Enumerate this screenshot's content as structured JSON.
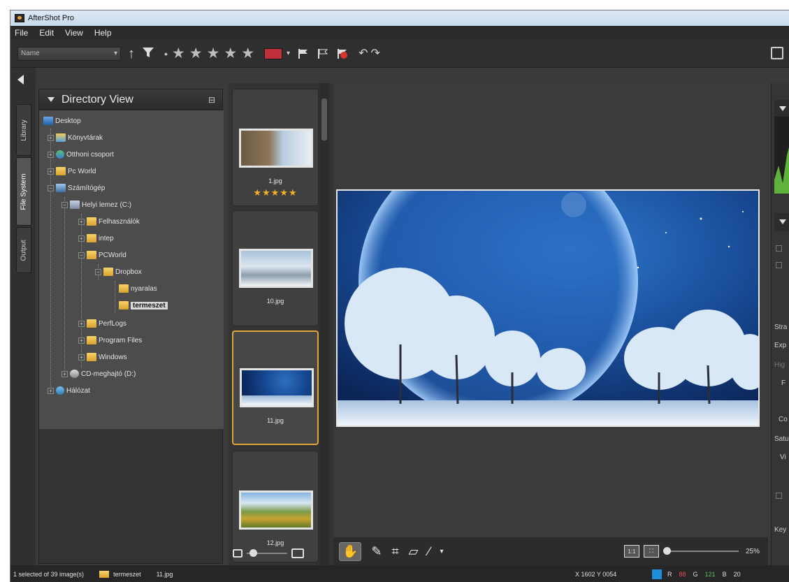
{
  "window": {
    "title": "AfterShot Pro"
  },
  "menu": [
    "File",
    "Edit",
    "View",
    "Help"
  ],
  "toolbar": {
    "sort_value": "Name",
    "rating_stars": 5,
    "color_label": "#c0303a"
  },
  "left_tabs": [
    "Library",
    "File System",
    "Output"
  ],
  "directory": {
    "title": "Directory View",
    "nodes": [
      "Desktop",
      "Könyvtárak",
      "Otthoni csoport",
      "Pc World",
      "Számítógép",
      "Helyi lemez (C:)",
      "Felhasználók",
      "intep",
      "PCWorld",
      "Dropbox",
      "nyaralas",
      "termeszet",
      "PerfLogs",
      "Program Files",
      "Windows",
      "CD-meghajtó (D:)",
      "Hálózat"
    ]
  },
  "thumbnails": [
    {
      "name": "1.jpg",
      "rating": "★★★★★",
      "selected": false
    },
    {
      "name": "10.jpg",
      "rating": "",
      "selected": false
    },
    {
      "name": "11.jpg",
      "rating": "",
      "selected": true
    },
    {
      "name": "12.jpg",
      "rating": "",
      "selected": false
    }
  ],
  "main_view": {
    "zoom": "25%"
  },
  "right_panel": {
    "labels": [
      "Stra",
      "Exp",
      "Hig",
      "F",
      "Co",
      "Satu",
      "Vi",
      "Key"
    ]
  },
  "status": {
    "selection": "1 selected of 39 image(s)",
    "folder": "termeszet",
    "file": "11.jpg",
    "coords": "X 1602 Y 0054",
    "r_label": "R",
    "r_value": "88",
    "g_label": "G",
    "g_value": "121",
    "b_label": "B",
    "b_value": "20"
  }
}
